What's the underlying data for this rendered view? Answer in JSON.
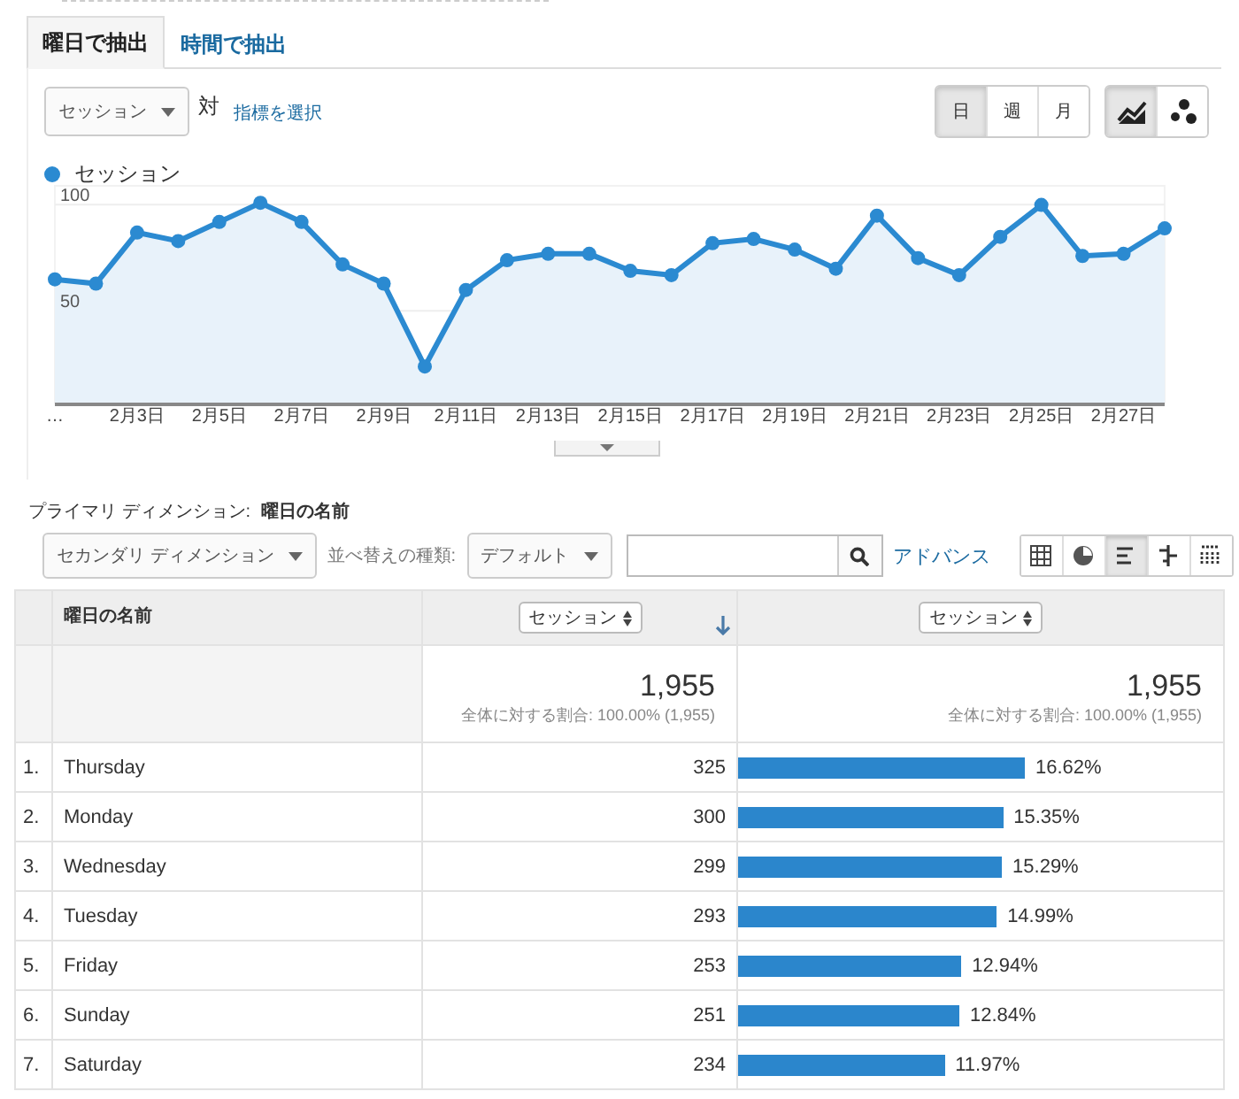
{
  "tabs": [
    {
      "label": "曜日で抽出",
      "selected": true
    },
    {
      "label": "時間で抽出",
      "selected": false
    }
  ],
  "metric_dropdown": {
    "value": "セッション"
  },
  "versus_label": "対",
  "select_metric_link": "指標を選択",
  "period_buttons": [
    {
      "label": "日",
      "selected": true
    },
    {
      "label": "週",
      "selected": false
    },
    {
      "label": "月",
      "selected": false
    }
  ],
  "chart_type_buttons": [
    {
      "kind": "line",
      "selected": true
    },
    {
      "kind": "motion",
      "selected": false
    }
  ],
  "chart_data": {
    "type": "area",
    "categories": [
      "…",
      null,
      "2月3日",
      null,
      "2月5日",
      null,
      "2月7日",
      null,
      "2月9日",
      null,
      "2月11日",
      null,
      "2月13日",
      null,
      "2月15日",
      null,
      "2月17日",
      null,
      "2月19日",
      null,
      "2月21日",
      null,
      "2月23日",
      null,
      "2月25日",
      null,
      "2月27日",
      null
    ],
    "series": [
      {
        "name": "セッション",
        "color": "#2b8ad1",
        "values": [
          64,
          62,
          86,
          82,
          91,
          100,
          91,
          71,
          62,
          23,
          59,
          73,
          76,
          76,
          68,
          66,
          81,
          83,
          78,
          69,
          94,
          74,
          66,
          84,
          99,
          75,
          76,
          88
        ]
      }
    ],
    "yticks": [
      50,
      100
    ],
    "ylim": [
      6,
      108
    ]
  },
  "primary_dimension": {
    "label": "プライマリ ディメンション:",
    "value": "曜日の名前"
  },
  "toolbar": {
    "secondary_dimension": "セカンダリ ディメンション",
    "sort_label": "並べ替えの種類:",
    "sort_value": "デフォルト",
    "advanced_link": "アドバンス",
    "view_buttons": [
      {
        "kind": "table",
        "selected": false
      },
      {
        "kind": "pie",
        "selected": false
      },
      {
        "kind": "performance",
        "selected": true
      },
      {
        "kind": "comparison",
        "selected": false
      },
      {
        "kind": "pivot",
        "selected": false
      }
    ]
  },
  "table": {
    "columns": [
      {
        "label": "曜日の名前",
        "sorted": false
      },
      {
        "label": "セッション",
        "sorted": true
      },
      {
        "label": "セッション",
        "sorted": false
      }
    ],
    "totals": [
      {
        "value": "1,955",
        "share": "全体に対する割合: 100.00% (1,955)"
      },
      {
        "value": "1,955",
        "share": "全体に対する割合: 100.00% (1,955)"
      }
    ],
    "rows": [
      {
        "rank": "1.",
        "name": "Thursday",
        "sessions": "325",
        "level": 0.6,
        "percent": "16.62%"
      },
      {
        "rank": "2.",
        "name": "Monday",
        "sessions": "300",
        "level": 0.554,
        "percent": "15.35%"
      },
      {
        "rank": "3.",
        "name": "Wednesday",
        "sessions": "299",
        "level": 0.552,
        "percent": "15.29%"
      },
      {
        "rank": "4.",
        "name": "Tuesday",
        "sessions": "293",
        "level": 0.541,
        "percent": "14.99%"
      },
      {
        "rank": "5.",
        "name": "Friday",
        "sessions": "253",
        "level": 0.467,
        "percent": "12.94%"
      },
      {
        "rank": "6.",
        "name": "Sunday",
        "sessions": "251",
        "level": 0.463,
        "percent": "12.84%"
      },
      {
        "rank": "7.",
        "name": "Saturday",
        "sessions": "234",
        "level": 0.432,
        "percent": "11.97%"
      }
    ]
  }
}
